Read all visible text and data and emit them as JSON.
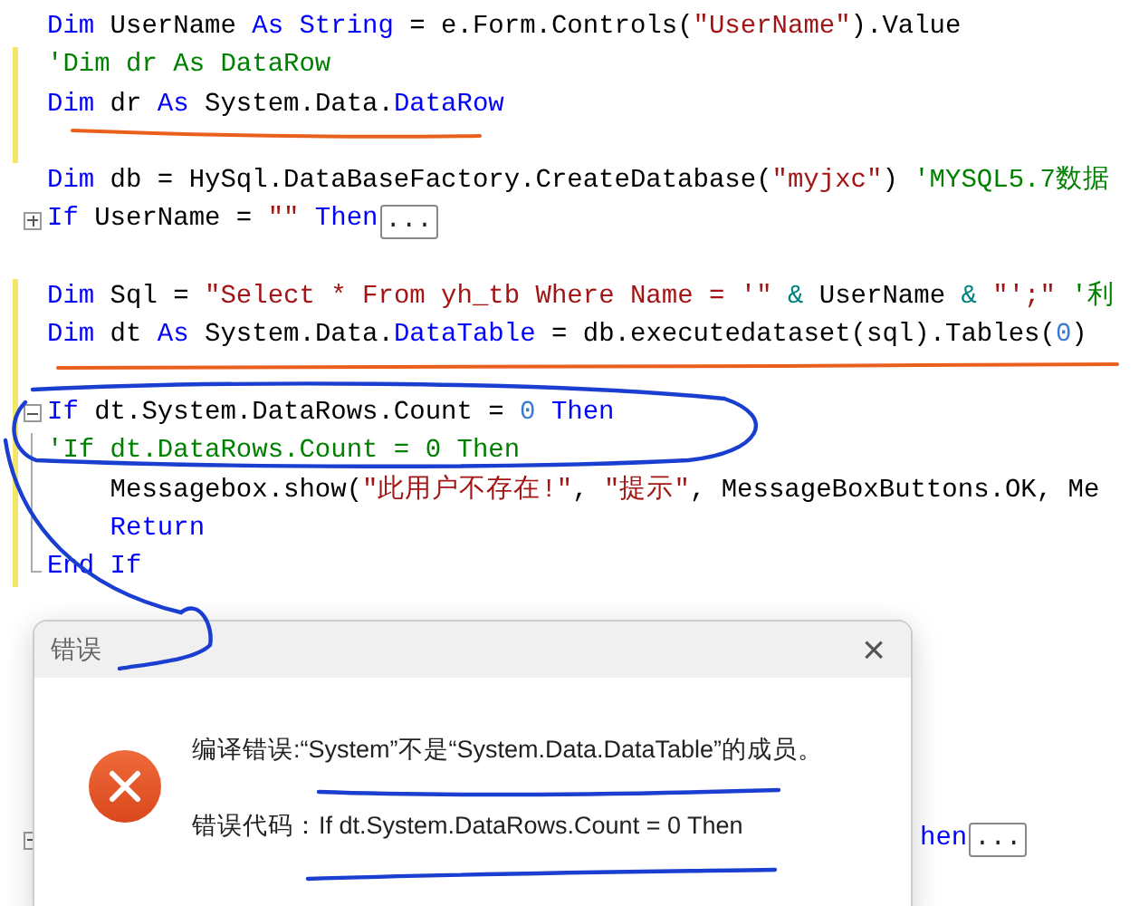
{
  "editor": {
    "lines": [
      {
        "tokens": [
          {
            "kind": "keyword",
            "t": "Dim"
          },
          {
            "kind": "plain",
            "t": " UserName "
          },
          {
            "kind": "keyword",
            "t": "As String"
          },
          {
            "kind": "plain",
            "t": " = e.Form.Controls("
          },
          {
            "kind": "string",
            "t": "\"UserName\""
          },
          {
            "kind": "plain",
            "t": ").Value"
          }
        ]
      },
      {
        "changed": true,
        "tokens": [
          {
            "kind": "comment",
            "t": "'Dim dr As DataRow"
          }
        ]
      },
      {
        "changed": true,
        "tokens": [
          {
            "kind": "keyword",
            "t": "Dim"
          },
          {
            "kind": "plain",
            "t": " dr "
          },
          {
            "kind": "keyword",
            "t": "As"
          },
          {
            "kind": "plain",
            "t": " System.Data."
          },
          {
            "kind": "keyword",
            "t": "DataRow"
          }
        ]
      },
      {
        "changed": true
      },
      {
        "tokens": [
          {
            "kind": "keyword",
            "t": "Dim"
          },
          {
            "kind": "plain",
            "t": " db = HySql.DataBaseFactory.CreateDatabase("
          },
          {
            "kind": "string",
            "t": "\"myjxc\""
          },
          {
            "kind": "plain",
            "t": ") "
          },
          {
            "kind": "comment",
            "t": "'MYSQL5.7数据"
          }
        ]
      },
      {
        "expanded": false,
        "collapsed_text": "...",
        "tokens": [
          {
            "kind": "keyword",
            "t": "If"
          },
          {
            "kind": "plain",
            "t": " UserName = "
          },
          {
            "kind": "string",
            "t": "\"\""
          },
          {
            "kind": "keyword",
            "t": " Then"
          }
        ]
      },
      {
        "blank_before": true,
        "changed": true,
        "tokens": [
          {
            "kind": "keyword",
            "t": "Dim"
          },
          {
            "kind": "plain",
            "t": " Sql = "
          },
          {
            "kind": "string",
            "t": "\"Select * From yh_tb Where Name = '\""
          },
          {
            "kind": "operator",
            "t": " &"
          },
          {
            "kind": "plain",
            "t": " UserName "
          },
          {
            "kind": "operator",
            "t": "&"
          },
          {
            "kind": "string",
            "t": " \"';\""
          },
          {
            "kind": "comment",
            "t": " '利"
          }
        ]
      },
      {
        "changed": true,
        "tokens": [
          {
            "kind": "keyword",
            "t": "Dim"
          },
          {
            "kind": "plain",
            "t": " dt "
          },
          {
            "kind": "keyword",
            "t": "As"
          },
          {
            "kind": "plain",
            "t": " System.Data."
          },
          {
            "kind": "keyword",
            "t": "DataTable"
          },
          {
            "kind": "plain",
            "t": " = db.executedataset(sql).Tables("
          },
          {
            "kind": "number",
            "t": "0"
          },
          {
            "kind": "plain",
            "t": ")"
          }
        ]
      },
      {
        "changed": true
      },
      {
        "changed": true,
        "expanded": true,
        "tokens": [
          {
            "kind": "keyword",
            "t": "If"
          },
          {
            "kind": "plain",
            "t": " dt.System.DataRows.Count = "
          },
          {
            "kind": "number",
            "t": "0"
          },
          {
            "kind": "keyword",
            "t": " Then"
          }
        ]
      },
      {
        "changed": true,
        "in_block": true,
        "tokens": [
          {
            "kind": "comment",
            "t": "'If dt.DataRows.Count = 0 Then"
          }
        ]
      },
      {
        "changed": true,
        "in_block": true,
        "tokens": [
          {
            "kind": "plain",
            "t": "    Messagebox.show("
          },
          {
            "kind": "string",
            "t": "\"此用户不存在!\""
          },
          {
            "kind": "plain",
            "t": ", "
          },
          {
            "kind": "string",
            "t": "\"提示\""
          },
          {
            "kind": "plain",
            "t": ", MessageBoxButtons.OK, Me"
          }
        ]
      },
      {
        "changed": true,
        "in_block": true,
        "tokens": [
          {
            "kind": "keyword",
            "t": "    Return"
          }
        ]
      },
      {
        "changed": true,
        "block_end": true,
        "tokens": [
          {
            "kind": "keyword",
            "t": "End If"
          }
        ]
      }
    ],
    "partial_line": {
      "collapsed_text": "...",
      "tokens": [
        {
          "kind": "keyword",
          "t": "hen"
        }
      ]
    }
  },
  "dialog": {
    "title": "错误",
    "close": "×",
    "message": "编译错误:“System”不是“System.Data.DataTable”的成员。",
    "detail": "错误代码：If dt.System.DataRows.Count = 0 Then"
  }
}
